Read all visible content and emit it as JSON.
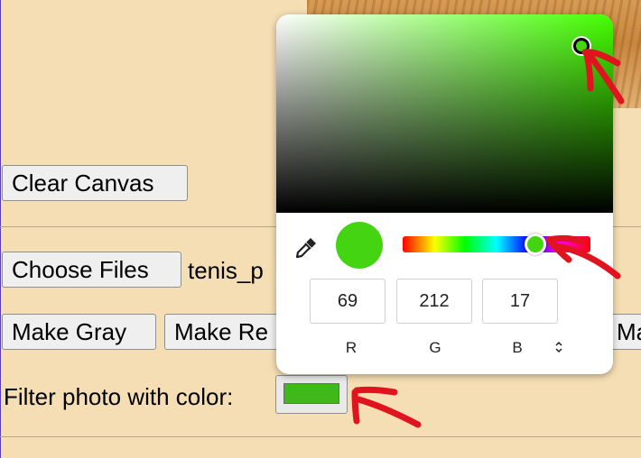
{
  "canvas": {
    "clear_label": "Clear Canvas"
  },
  "file": {
    "choose_label": "Choose Files",
    "filename": "tenis_p"
  },
  "filters": {
    "make_gray_label": "Make Gray",
    "make_red_label": "Make Re",
    "next_partial_label": "Ma"
  },
  "filter_color": {
    "label": "Filter photo with color:",
    "swatch_color": "#3fb81a"
  },
  "color_picker": {
    "current_color": "#45d411",
    "r": "69",
    "g": "212",
    "b": "17",
    "r_label": "R",
    "g_label": "G",
    "b_label": "B",
    "format_toggle": "⌃⌄"
  },
  "colors": {
    "page_bg": "#f5deb3",
    "annotation": "#e0141e"
  }
}
